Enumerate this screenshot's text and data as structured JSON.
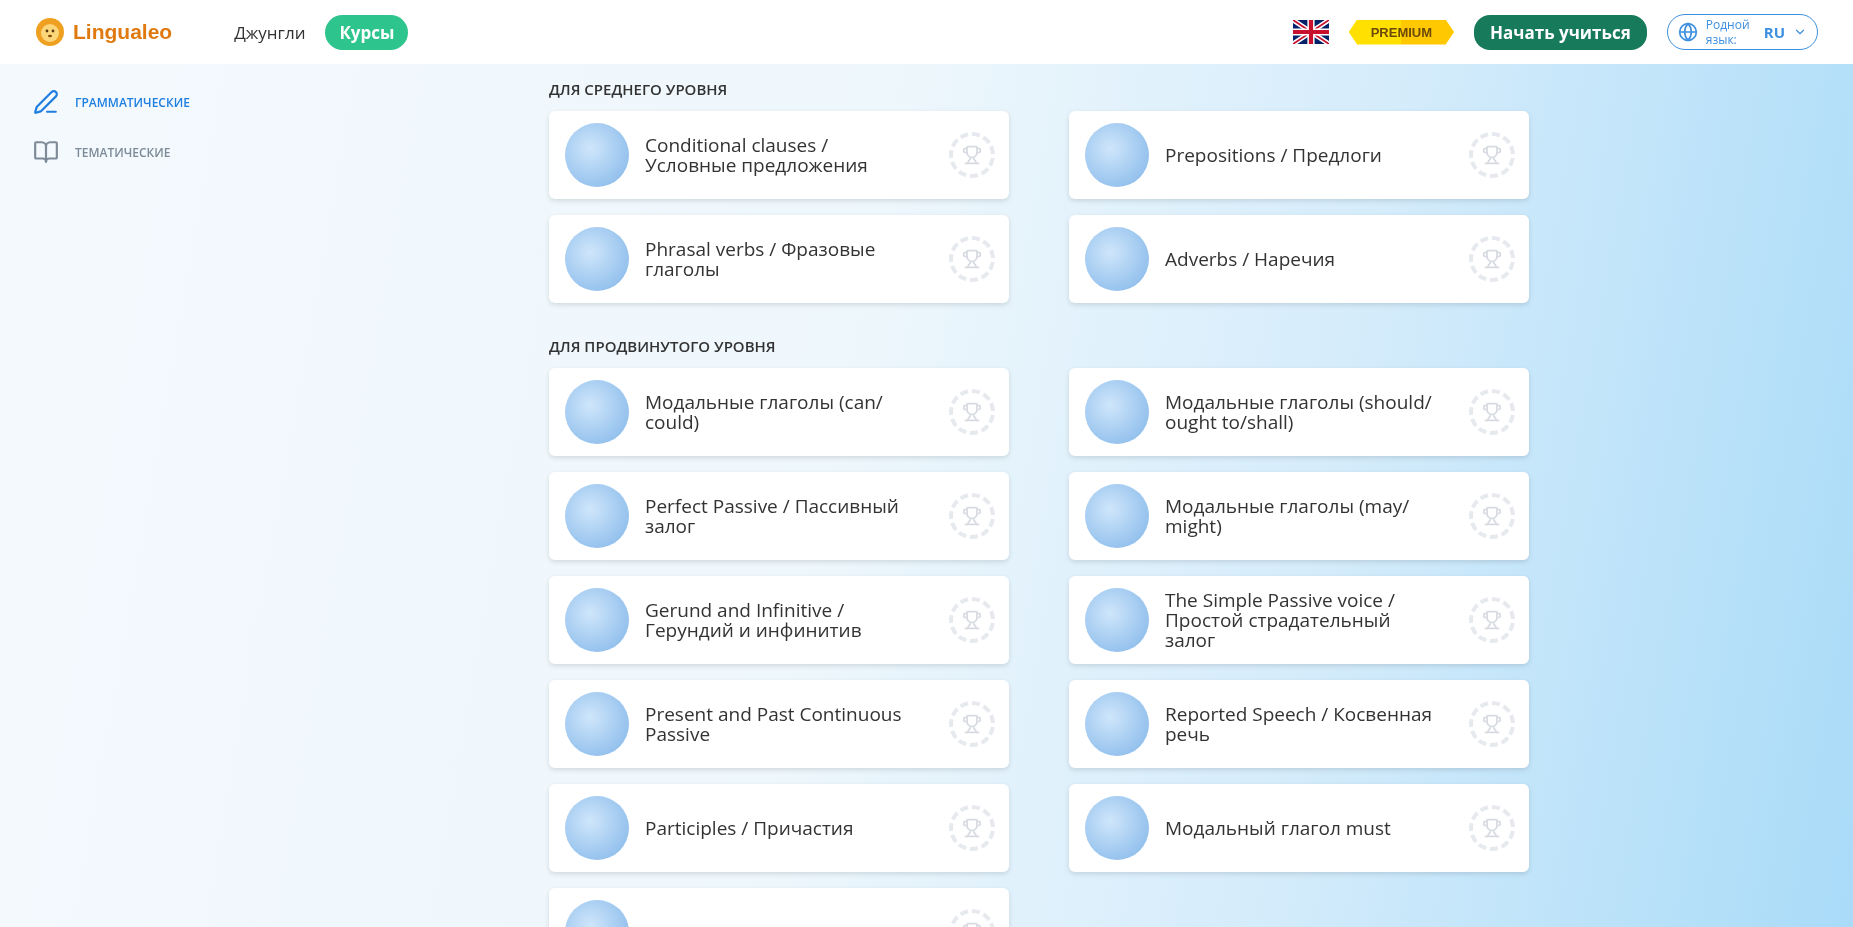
{
  "header": {
    "logo": "Lingualeo",
    "nav": [
      {
        "label": "Джунгли",
        "selected": false
      },
      {
        "label": "Курсы",
        "selected": true
      }
    ],
    "premium": "PREMIUM",
    "start_button": "Начать учиться",
    "language": {
      "label": "Родной язык:",
      "value": "RU"
    }
  },
  "sidebar": {
    "items": [
      {
        "kind": "pen",
        "label": "ГРАММАТИЧЕСКИЕ",
        "selected": true
      },
      {
        "kind": "book",
        "label": "ТЕМАТИЧЕСКИЕ",
        "selected": false
      }
    ]
  },
  "sections": [
    {
      "title": "ДЛЯ СРЕДНЕГО УРОВНЯ",
      "courses": [
        {
          "title": "Conditional clauses / Условные предложения"
        },
        {
          "title": "Prepositions / Предлоги"
        },
        {
          "title": "Phrasal verbs / Фразовые глаголы"
        },
        {
          "title": "Adverbs / Наречия"
        }
      ]
    },
    {
      "title": "ДЛЯ ПРОДВИНУТОГО УРОВНЯ",
      "courses": [
        {
          "title": "Модальные глаголы (can/ could)"
        },
        {
          "title": "Модальные глаголы (should/ ought to/shall)"
        },
        {
          "title": "Perfect Passive / Пассивный залог"
        },
        {
          "title": "Модальные глаголы (may/ might)"
        },
        {
          "title": "Gerund and Infinitive / Герундий и инфинитив"
        },
        {
          "title": "The Simple Passive voice / Простой страдательный залог"
        },
        {
          "title": "Present and Past Continuous Passive"
        },
        {
          "title": "Reported Speech / Косвенная речь"
        },
        {
          "title": "Participles / Причастия"
        },
        {
          "title": "Модальный глагол must"
        },
        {
          "kind": "cut_off"
        }
      ]
    }
  ]
}
